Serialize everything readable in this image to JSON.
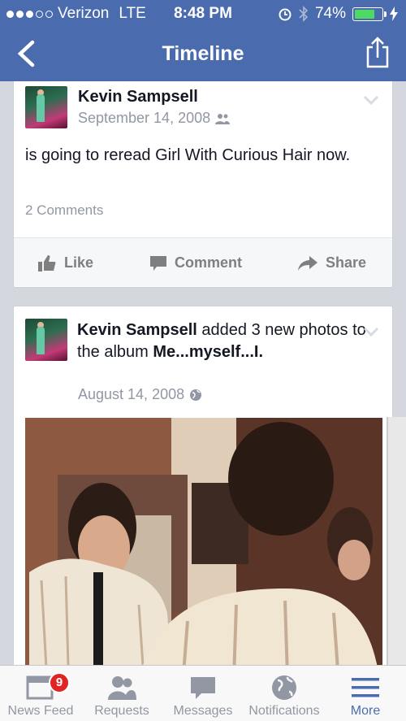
{
  "status_bar": {
    "carrier": "Verizon",
    "network": "LTE",
    "time": "8:48 PM",
    "battery": "74%",
    "battery_level": 0.74
  },
  "nav": {
    "title": "Timeline"
  },
  "post1": {
    "author": "Kevin Sampsell",
    "date": "September 14, 2008",
    "text": "is going to reread Girl With Curious Hair now.",
    "comments": "2 Comments",
    "actions": {
      "like": "Like",
      "comment": "Comment",
      "share": "Share"
    }
  },
  "post2": {
    "author": "Kevin Sampsell",
    "action_text": " added 3 new photos to the album ",
    "album": "Me...myself...I.",
    "date": "August 14, 2008"
  },
  "tabbar": {
    "items": [
      {
        "label": "News Feed",
        "icon": "news-feed-icon",
        "badge": "9"
      },
      {
        "label": "Requests",
        "icon": "friends-icon"
      },
      {
        "label": "Messages",
        "icon": "messages-icon"
      },
      {
        "label": "Notifications",
        "icon": "globe-icon"
      },
      {
        "label": "More",
        "icon": "menu-icon"
      }
    ]
  },
  "colors": {
    "brand": "#4a6cae",
    "badge": "#e02323",
    "battery": "#4cd964"
  }
}
